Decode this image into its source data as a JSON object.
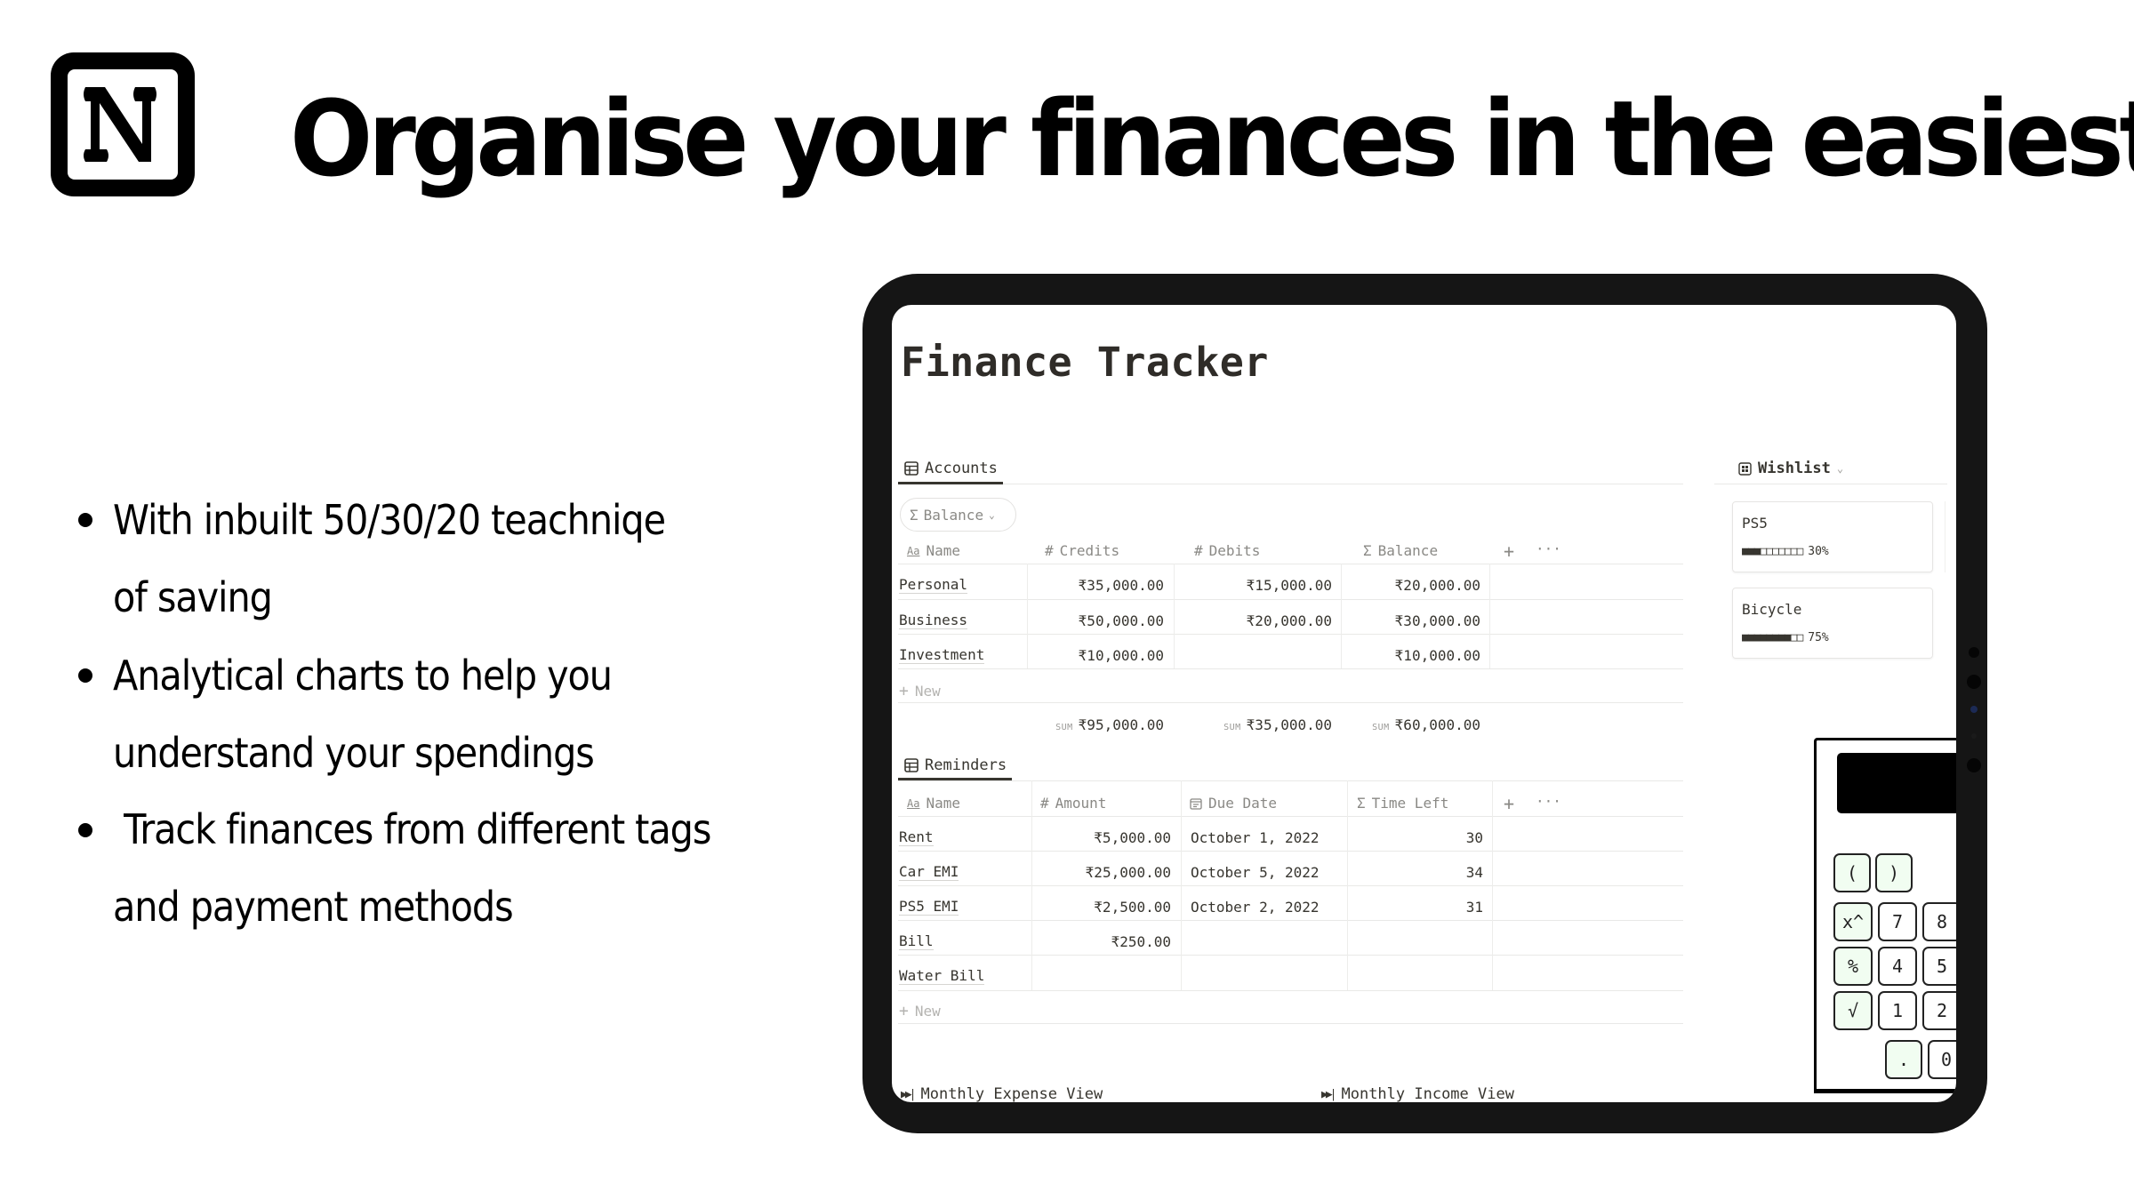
{
  "brand": {
    "logo_icon": "notion-logo-icon"
  },
  "headline": "Organise your finances in the easiest way",
  "features": [
    {
      "lines": [
        "With inbuilt 50/30/20 teachniqe",
        "of saving"
      ]
    },
    {
      "lines": [
        "Analytical charts to help you",
        "understand your spendings"
      ]
    },
    {
      "lines": [
        " Track finances from different tags",
        "and payment methods"
      ]
    }
  ],
  "app": {
    "page_title": "Finance Tracker",
    "accounts": {
      "tab_label": "Accounts",
      "tab_icon": "table-icon",
      "filter_pill": "Balance",
      "columns": [
        {
          "icon": "Aa",
          "label": "Name"
        },
        {
          "icon": "#",
          "label": "Credits"
        },
        {
          "icon": "#",
          "label": "Debits"
        },
        {
          "icon": "Σ",
          "label": "Balance"
        }
      ],
      "rows": [
        {
          "name": "Personal",
          "credits": "₹35,000.00",
          "debits": "₹15,000.00",
          "balance": "₹20,000.00"
        },
        {
          "name": "Business",
          "credits": "₹50,000.00",
          "debits": "₹20,000.00",
          "balance": "₹30,000.00"
        },
        {
          "name": "Investment",
          "credits": "₹10,000.00",
          "debits": "",
          "balance": "₹10,000.00"
        }
      ],
      "new_label": "New",
      "sum_label": "SUM",
      "sums": {
        "credits": "₹95,000.00",
        "debits": "₹35,000.00",
        "balance": "₹60,000.00"
      },
      "add_column": "+",
      "more": "···"
    },
    "reminders": {
      "tab_label": "Reminders",
      "tab_icon": "table-icon",
      "columns": [
        {
          "icon": "Aa",
          "label": "Name"
        },
        {
          "icon": "#",
          "label": "Amount"
        },
        {
          "icon": "calendar",
          "label": "Due Date"
        },
        {
          "icon": "Σ",
          "label": "Time Left"
        }
      ],
      "rows": [
        {
          "name": "Rent",
          "amount": "₹5,000.00",
          "due": "October 1, 2022",
          "left": "30"
        },
        {
          "name": "Car EMI",
          "amount": "₹25,000.00",
          "due": "October 5, 2022",
          "left": "34"
        },
        {
          "name": "PS5 EMI",
          "amount": "₹2,500.00",
          "due": "October 2, 2022",
          "left": "31"
        },
        {
          "name": "Bill",
          "amount": "₹250.00",
          "due": "",
          "left": ""
        },
        {
          "name": "Water Bill",
          "amount": "",
          "due": "",
          "left": ""
        }
      ],
      "new_label": "New",
      "add_column": "+",
      "more": "···"
    },
    "links": [
      {
        "icon": "fast-forward-icon",
        "label": "Monthly Expense View"
      },
      {
        "icon": "fast-forward-icon",
        "label": "Monthly Income View"
      }
    ],
    "wishlist": {
      "title": "Wishlist",
      "items": [
        {
          "name": "PS5",
          "progress_bar": "■■■□□□□□□□",
          "progress": "30%"
        },
        {
          "name": "Bicycle",
          "progress_bar": "■■■■■■■■□□",
          "progress": "75%"
        }
      ]
    },
    "calculator": {
      "keys": [
        "(",
        ")",
        "x^",
        "7",
        "8",
        "%",
        "4",
        "5",
        "√",
        "1",
        "2",
        ".",
        "0"
      ]
    }
  }
}
